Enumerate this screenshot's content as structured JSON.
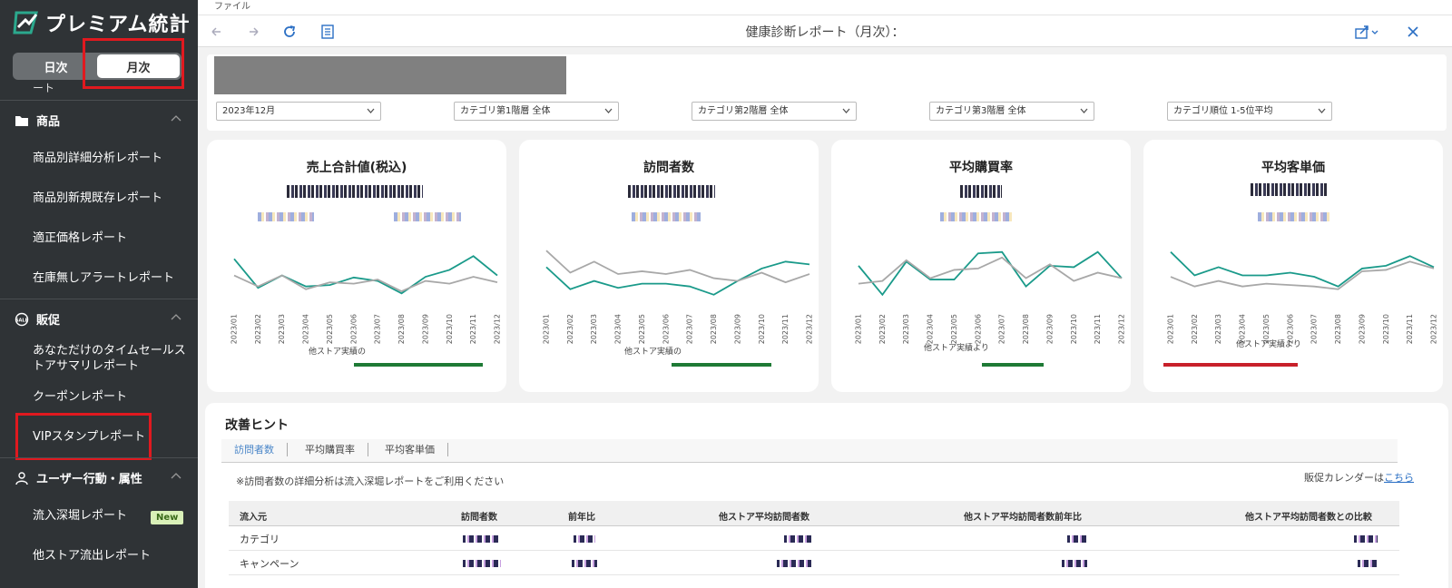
{
  "app": {
    "name": "プレミアム統計"
  },
  "sidebar": {
    "toggle": {
      "daily": "日次",
      "monthly": "月次",
      "selected": "monthly"
    },
    "truncated_item": "ート",
    "sections": [
      {
        "label": "商品",
        "icon": "folder-icon",
        "items": [
          "商品別詳細分析レポート",
          "商品別新規既存レポート",
          "適正価格レポート",
          "在庫無しアラートレポート"
        ]
      },
      {
        "label": "販促",
        "icon": "sale-icon",
        "items": [
          "あなただけのタイムセールストアサマリレポート",
          "クーポンレポート",
          "VIPスタンプレポート"
        ]
      },
      {
        "label": "ユーザー行動・属性",
        "icon": "user-icon",
        "items": [
          "流入深堀レポート",
          "他ストア流出レポート"
        ]
      }
    ],
    "timesale_lines": [
      "あなただけのタイムセールス",
      "トアサマリレポート"
    ],
    "new_badge": "New"
  },
  "menubar": {
    "file": "ファイル"
  },
  "toolbar": {
    "title": "健康診断レポート（月次）："
  },
  "filters": [
    {
      "value": "2023年12月"
    },
    {
      "value": "カテゴリ第1階層 全体"
    },
    {
      "value": "カテゴリ第2階層 全体"
    },
    {
      "value": "カテゴリ第3階層 全体"
    },
    {
      "value": "カテゴリ順位 1-5位平均"
    }
  ],
  "kpis": [
    {
      "title": "売上合計値(税込)",
      "compare_label": "他ストア実績の",
      "bar_color": "#1e7a35"
    },
    {
      "title": "訪問者数",
      "compare_label": "他ストア実績の",
      "bar_color": "#1e7a35"
    },
    {
      "title": "平均購買率",
      "compare_label": "他ストア実績より",
      "bar_color": "#1e7a35"
    },
    {
      "title": "平均客単価",
      "compare_label": "他ストア実績より",
      "bar_color": "#c8202a"
    }
  ],
  "chart_data": [
    {
      "type": "line",
      "x": [
        "2023/01",
        "2023/02",
        "2023/03",
        "2023/04",
        "2023/05",
        "2023/06",
        "2023/07",
        "2023/08",
        "2023/09",
        "2023/10",
        "2023/11",
        "2023/12"
      ],
      "series": [
        {
          "color": "#1a9a8a",
          "values": [
            72,
            30,
            48,
            32,
            34,
            45,
            40,
            22,
            46,
            56,
            76,
            48
          ]
        },
        {
          "color": "#a8a8a8",
          "values": [
            48,
            32,
            48,
            28,
            38,
            36,
            42,
            25,
            40,
            36,
            46,
            38
          ]
        }
      ],
      "ylim": [
        0,
        100
      ]
    },
    {
      "type": "line",
      "x": [
        "2023/01",
        "2023/02",
        "2023/03",
        "2023/04",
        "2023/05",
        "2023/06",
        "2023/07",
        "2023/08",
        "2023/09",
        "2023/10",
        "2023/11",
        "2023/12"
      ],
      "series": [
        {
          "color": "#1a9a8a",
          "values": [
            60,
            28,
            40,
            30,
            36,
            36,
            32,
            20,
            40,
            58,
            68,
            64
          ]
        },
        {
          "color": "#a8a8a8",
          "values": [
            84,
            52,
            68,
            50,
            54,
            50,
            56,
            44,
            40,
            52,
            38,
            50
          ]
        }
      ],
      "ylim": [
        0,
        100
      ]
    },
    {
      "type": "line",
      "x": [
        "2023/01",
        "2023/02",
        "2023/03",
        "2023/04",
        "2023/05",
        "2023/06",
        "2023/07",
        "2023/08",
        "2023/09",
        "2023/10",
        "2023/11",
        "2023/12"
      ],
      "series": [
        {
          "color": "#1a9a8a",
          "values": [
            62,
            20,
            68,
            42,
            42,
            80,
            82,
            32,
            62,
            60,
            82,
            44
          ]
        },
        {
          "color": "#a8a8a8",
          "values": [
            36,
            40,
            70,
            44,
            56,
            58,
            74,
            44,
            64,
            40,
            52,
            44
          ]
        }
      ],
      "ylim": [
        0,
        100
      ]
    },
    {
      "type": "line",
      "x": [
        "2023/01",
        "2023/02",
        "2023/03",
        "2023/04",
        "2023/05",
        "2023/06",
        "2023/07",
        "2023/08",
        "2023/09",
        "2023/10",
        "2023/11",
        "2023/12"
      ],
      "series": [
        {
          "color": "#1a9a8a",
          "values": [
            82,
            48,
            60,
            48,
            48,
            52,
            46,
            32,
            58,
            62,
            76,
            60
          ]
        },
        {
          "color": "#a8a8a8",
          "values": [
            46,
            32,
            40,
            32,
            36,
            34,
            32,
            28,
            54,
            56,
            68,
            58
          ]
        }
      ],
      "ylim": [
        0,
        100
      ]
    }
  ],
  "hints": {
    "title": "改善ヒント",
    "tabs": [
      "訪問者数",
      "平均購買率",
      "平均客単価"
    ],
    "note": "※訪問者数の詳細分析は流入深堀レポートをご利用ください",
    "calendar_prefix": "販促カレンダーは",
    "calendar_link": "こちら",
    "columns": [
      "流入元",
      "訪問者数",
      "前年比",
      "他ストア平均訪問者数",
      "他ストア平均訪問者数前年比",
      "他ストア平均訪問者数との比較"
    ],
    "rows": [
      "カテゴリ",
      "キャンペーン"
    ]
  }
}
